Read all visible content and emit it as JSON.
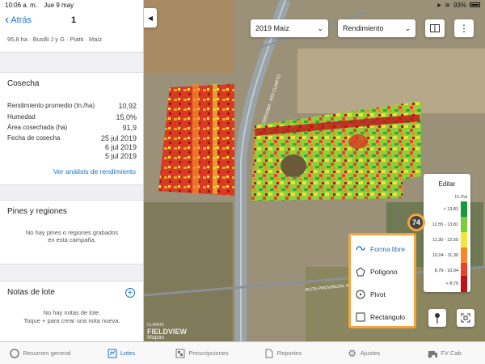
{
  "status": {
    "time": "10:06 a. m.",
    "date": "Jue 9 may",
    "battery": "93%"
  },
  "nav": {
    "back": "Atrás",
    "title": "1"
  },
  "field_info": "95,8 ha · Busilli J y G · Piatti · Maíz",
  "cosecha": {
    "title": "Cosecha",
    "rows": [
      {
        "label": "Rendimiento promedio (tn./ha)",
        "value": "10,92"
      },
      {
        "label": "Humedad",
        "value": "15,0%"
      },
      {
        "label": "Área cosechada (ha)",
        "value": "91,9"
      },
      {
        "label": "Fecha de cosecha",
        "value": "25 jul 2019"
      }
    ],
    "extra_dates": [
      "6 jul 2019",
      "5 jul 2019"
    ],
    "link": "Ver análisis de rendimiento"
  },
  "pines": {
    "title": "Pines y regiones",
    "empty_line1": "No hay pines o regiones grabados",
    "empty_line2": "en esta campaña."
  },
  "notas": {
    "title": "Notas de lote",
    "add": "+",
    "empty_line1": "No hay notas de lote.",
    "empty_line2": "Toque + para crear una nota nueva."
  },
  "map": {
    "season_select": "2019 Maíz",
    "layer_select": "Rendimiento",
    "road1": "AUTOVÍA CÓRDOBA - RÍO CUARTO",
    "road2": "RUTA PROVINCIAL 4",
    "brand_line1": "CLIMATE",
    "brand_line2": "FIELDVIEW",
    "brand_line3": "Mapas",
    "badge": "74"
  },
  "legend": {
    "edit": "Editar",
    "unit": "tn./ha",
    "rows": [
      {
        "label": "> 13,81",
        "color": "#1a9641"
      },
      {
        "label": "12,55 - 13,81",
        "color": "#7ccb3b"
      },
      {
        "label": "11,30 - 12,55",
        "color": "#f2e63a"
      },
      {
        "label": "10,04 - 11,30",
        "color": "#f28a2c"
      },
      {
        "label": "8,79 - 10,04",
        "color": "#e8452c"
      },
      {
        "label": "< 8,79",
        "color": "#c0101a"
      }
    ]
  },
  "draw_tools": [
    {
      "label": "Forma libre",
      "icon": "freeform-icon"
    },
    {
      "label": "Polígono",
      "icon": "polygon-icon"
    },
    {
      "label": "Pivot",
      "icon": "pivot-icon"
    },
    {
      "label": "Rectángulo",
      "icon": "rectangle-icon"
    }
  ],
  "tabs": [
    {
      "label": "Resumen general",
      "icon": "summary-icon"
    },
    {
      "label": "Lotes",
      "icon": "fields-icon"
    },
    {
      "label": "Prescripciones",
      "icon": "prescriptions-icon"
    },
    {
      "label": "Reportes",
      "icon": "reports-icon"
    },
    {
      "label": "Ajustes",
      "icon": "gear-icon"
    },
    {
      "label": "FV Cab",
      "icon": "tractor-icon"
    }
  ],
  "colors": {
    "accent": "#1a73c8",
    "highlight": "#f4a43a"
  }
}
